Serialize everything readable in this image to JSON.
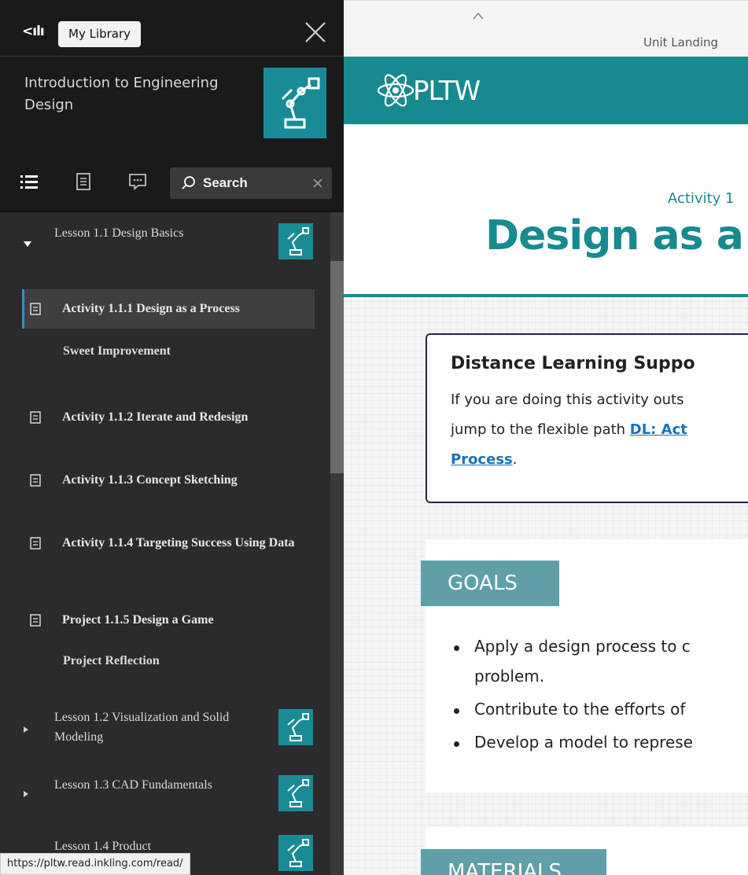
{
  "sidebar": {
    "back_glyph": "<ılı",
    "tooltip": "My Library",
    "book_title": "Introduction to Engineering Design",
    "search_placeholder": "Search",
    "lessons": [
      {
        "label": "Lesson 1.1 Design Basics",
        "expanded": true
      },
      {
        "label": "Lesson 1.2 Visualization and Solid Modeling",
        "expanded": false
      },
      {
        "label": "Lesson 1.3 CAD Fundamentals",
        "expanded": false
      },
      {
        "label": "Lesson 1.4 Product",
        "expanded": false
      }
    ],
    "activities": [
      {
        "label": "Activity 1.1.1 Design as a Process",
        "current": true
      },
      {
        "label": "Activity 1.1.2 Iterate and Redesign"
      },
      {
        "label": "Activity 1.1.3 Concept Sketching"
      },
      {
        "label": "Activity 1.1.4 Targeting Success Using Data"
      },
      {
        "label": "Project 1.1.5 Design a Game"
      }
    ],
    "subitems": [
      {
        "label": "Sweet Improvement"
      },
      {
        "label": "Project Reflection"
      }
    ]
  },
  "status_url": "https://pltw.read.inkling.com/read/",
  "main": {
    "unit_label": "Unit Landing",
    "brand": "PLTW",
    "activity_label": "Activity 1",
    "page_title": "Design as a",
    "dl_box": {
      "title": "Distance Learning Suppo",
      "line1": "If you are doing this activity outs",
      "line2_pre": "jump to the flexible path ",
      "line2_link": "DL: Act",
      "line3_link": "Process",
      "line3_post": "."
    },
    "goals_heading": "GOALS",
    "goals": [
      "Apply a design process to c",
      "problem.",
      "Contribute to the efforts of",
      "Develop a model to represe"
    ],
    "materials_heading": "MATERIALS"
  },
  "colors": {
    "teal": "#178a8f",
    "goal_tab": "#5e9fa8",
    "sidebar_bg": "#2b2b2d",
    "current_marker": "#2f8fd8"
  }
}
